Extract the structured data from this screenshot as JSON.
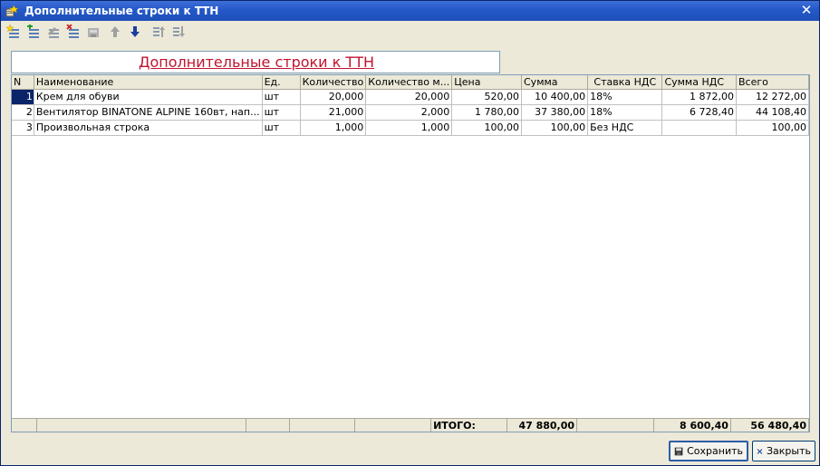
{
  "window": {
    "title": "Дополнительные строки к ТТН",
    "close_glyph": "✕"
  },
  "toolbar": {
    "buttons": [
      {
        "icon": "add-row-icon"
      },
      {
        "icon": "add-copy-row-icon"
      },
      {
        "icon": "edit-row-icon"
      },
      {
        "icon": "delete-row-icon"
      },
      {
        "icon": "end-edit-icon"
      },
      {
        "icon": "move-up-icon"
      },
      {
        "icon": "move-down-icon"
      },
      {
        "icon": "sort-asc-icon"
      },
      {
        "icon": "sort-desc-icon"
      }
    ]
  },
  "header": {
    "title": "Дополнительные строки к ТТН"
  },
  "table": {
    "columns": [
      "N",
      "Наименование",
      "Ед.",
      "Количество",
      "Количество м...",
      "Цена",
      "Сумма",
      "Ставка НДС",
      "Сумма НДС",
      "Всего"
    ],
    "rows": [
      {
        "n": "1",
        "name": "Крем для обуви",
        "unit": "шт",
        "qty": "20,000",
        "qty_m": "20,000",
        "price": "520,00",
        "sum": "10 400,00",
        "vat_rate": "18%",
        "vat_sum": "1 872,00",
        "total": "12 272,00"
      },
      {
        "n": "2",
        "name": "Вентилятор BINATONE ALPINE 160вт, нап...",
        "unit": "шт",
        "qty": "21,000",
        "qty_m": "2,000",
        "price": "1 780,00",
        "sum": "37 380,00",
        "vat_rate": "18%",
        "vat_sum": "6 728,40",
        "total": "44 108,40"
      },
      {
        "n": "3",
        "name": "Произвольная строка",
        "unit": "шт",
        "qty": "1,000",
        "qty_m": "1,000",
        "price": "100,00",
        "sum": "100,00",
        "vat_rate": "Без НДС",
        "vat_sum": "",
        "total": "100,00"
      }
    ],
    "footer": {
      "label": "ИТОГО:",
      "sum": "47 880,00",
      "vat_sum": "8 600,40",
      "total": "56 480,40"
    }
  },
  "buttons": {
    "save": "Сохранить",
    "close": "Закрыть"
  },
  "colors": {
    "title_bar": "#2458C8",
    "header_title": "#C0142F",
    "selection": "#0A246A"
  }
}
